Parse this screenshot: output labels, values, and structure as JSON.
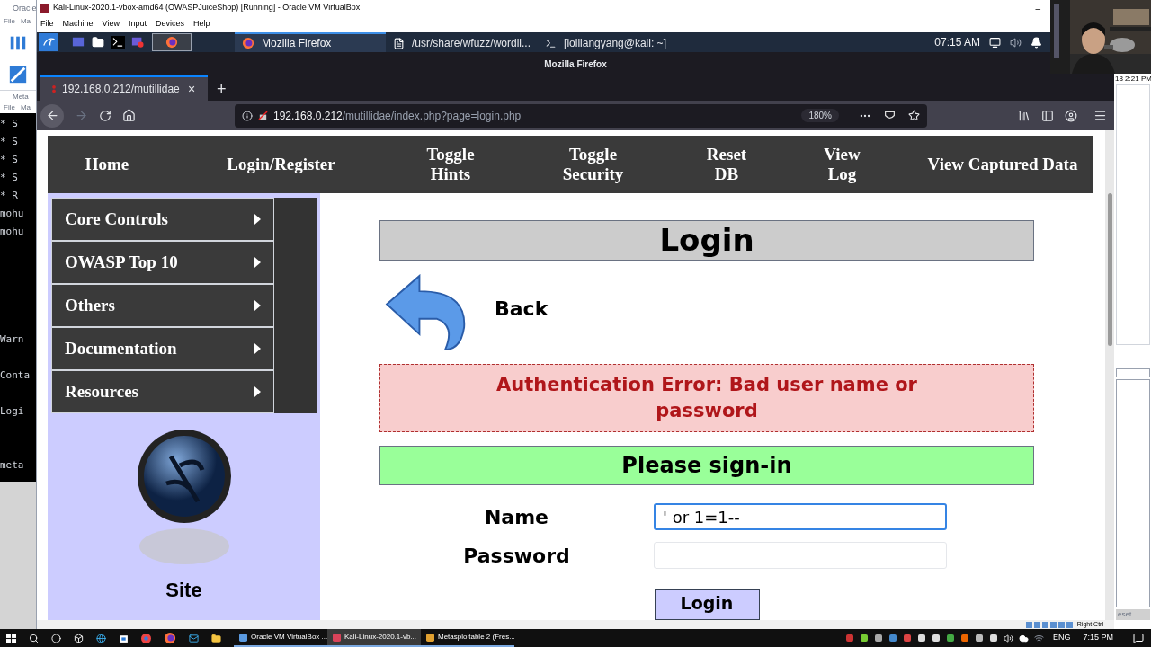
{
  "background_left": {
    "window_title": "Oracle",
    "menu": [
      "File",
      "Ma"
    ],
    "second_window_title": "Meta",
    "second_menu": [
      "File",
      "Ma"
    ],
    "terminal_blocks": [
      [
        "* S",
        "* S",
        "* S",
        "* S",
        "* R",
        "mohu",
        "mohu"
      ],
      [
        "Warn"
      ],
      [
        "Conta"
      ],
      [
        "Logi"
      ],
      [
        "meta"
      ]
    ]
  },
  "vm_window": {
    "title": "Kali-Linux-2020.1-vbox-amd64 (OWASPJuiceShop) [Running] - Oracle VM VirtualBox",
    "menu": [
      "File",
      "Machine",
      "View",
      "Input",
      "Devices",
      "Help"
    ],
    "status_text": "Right Ctrl",
    "minimize": "–"
  },
  "kali_panel": {
    "tasks": [
      {
        "label": "Mozilla Firefox",
        "kind": "browser",
        "selected": true
      },
      {
        "label": "/usr/share/wfuzz/wordli...",
        "kind": "document",
        "selected": false
      },
      {
        "label": "[loiliangyang@kali: ~]",
        "kind": "terminal",
        "selected": false
      }
    ],
    "clock": "07:15 AM"
  },
  "firefox": {
    "window_title": "Mozilla Firefox",
    "tabs": [
      {
        "label": "192.168.0.212/mutillidae",
        "selected": true,
        "close": "×"
      }
    ],
    "new_tab": "+",
    "url_host": "192.168.0.212",
    "url_path": "/mutillidae/index.php?page=login.php",
    "zoom": "180%"
  },
  "page": {
    "nav": [
      "Home",
      "Login/Register",
      "Toggle Hints",
      "Toggle Security",
      "Reset DB",
      "View Log",
      "View Captured Data"
    ],
    "sidebar": [
      "Core Controls",
      "OWASP Top 10",
      "Others",
      "Documentation",
      "Resources"
    ],
    "site_label": "Site",
    "title": "Login",
    "back": "Back",
    "error": "Authentication Error: Bad user name or password",
    "signin": "Please sign-in",
    "fields": [
      {
        "label": "Name",
        "value": "' or 1=1--",
        "focused": true
      },
      {
        "label": "Password",
        "focused": false
      }
    ],
    "login_button": "Login"
  },
  "right_background": {
    "time_text": "18 2:21 PM",
    "button": "eset"
  },
  "taskbar": {
    "items": [
      {
        "label": "Oracle VM VirtualBox ...",
        "selected": false
      },
      {
        "label": "Kali-Linux-2020.1-vb...",
        "selected": true
      },
      {
        "label": "Metasploitable 2 (Fres...",
        "selected": false
      }
    ],
    "language": "ENG",
    "clock": "7:15 PM"
  }
}
